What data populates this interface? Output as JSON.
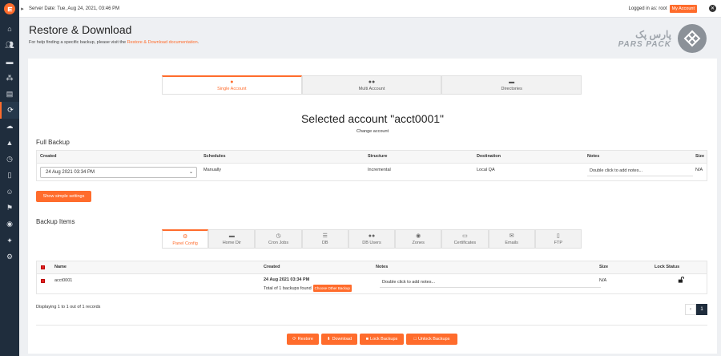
{
  "topbar": {
    "server_date": "Server Date: Tue, Aug 24, 2021, 03:46 PM",
    "logged_in": "Logged in as: root",
    "my_account": "My Account"
  },
  "header": {
    "title": "Restore & Download",
    "help_prefix": "For help finding a specific backup, please visit the",
    "help_link": "Restore & Download documentation",
    "help_suffix": "."
  },
  "brand": {
    "fa_text": "پارس پک",
    "en_text": "PARS PACK"
  },
  "sidebar": {
    "icons": [
      "home-icon",
      "users-icon",
      "folder-icon",
      "cluster-icon",
      "server-icon",
      "restore-icon",
      "cloud-upload-icon",
      "warning-icon",
      "clock-icon",
      "file-icon",
      "user-group-icon",
      "flag-icon",
      "plugin-icon",
      "settings-icon",
      "gear-icon"
    ]
  },
  "account_tabs": [
    {
      "label": "Single Account",
      "icon": "user-icon",
      "active": true
    },
    {
      "label": "Multi Account",
      "icon": "users-icon",
      "active": false
    },
    {
      "label": "Directories",
      "icon": "folder-icon",
      "active": false
    }
  ],
  "selected_account": "Selected account \"acct0001\"",
  "change_account": "Change account",
  "full_backup": {
    "title": "Full Backup",
    "columns": [
      "Created",
      "Schedules",
      "Structure",
      "Destination",
      "Notes",
      "Size"
    ],
    "selected_date": "24 Aug 2021 03:34 PM",
    "schedules": "Manually",
    "structure": "Incremental",
    "destination": "Local QA",
    "notes_placeholder": "Double click to add notes...",
    "size": "N/A",
    "simple_settings_button": "Show simple settings"
  },
  "backup_items": {
    "title": "Backup Items",
    "tabs": [
      {
        "label": "Panel Config",
        "icon": "gear-icon",
        "active": true
      },
      {
        "label": "Home Dir",
        "icon": "folder-icon",
        "active": false
      },
      {
        "label": "Cron Jobs",
        "icon": "clock-icon",
        "active": false
      },
      {
        "label": "DB",
        "icon": "database-icon",
        "active": false
      },
      {
        "label": "DB Users",
        "icon": "users-icon",
        "active": false
      },
      {
        "label": "Zones",
        "icon": "map-pin-icon",
        "active": false
      },
      {
        "label": "Certificates",
        "icon": "certificate-icon",
        "active": false
      },
      {
        "label": "Emails",
        "icon": "envelope-icon",
        "active": false
      },
      {
        "label": "FTP",
        "icon": "file-icon",
        "active": false
      }
    ],
    "columns": [
      "Name",
      "Created",
      "Notes",
      "Size",
      "Lock Status"
    ],
    "row": {
      "name": "acct0001",
      "created": "24 Aug 2021 03:34 PM",
      "total": "Total of 1 backups found",
      "choose_other": "Choose Other Backup",
      "notes_placeholder": "Double click to add notes...",
      "size": "N/A"
    },
    "displaying": "Displaying 1 to 1 out of 1 records",
    "pager": {
      "prev": "‹",
      "current": "1"
    }
  },
  "actions": {
    "restore": "Restore",
    "download": "Download",
    "lock": "Lock Backups",
    "unlock": "Unlock Backups"
  },
  "colors": {
    "accent": "#ff6c2c",
    "sidebar": "#1f2d3d"
  }
}
